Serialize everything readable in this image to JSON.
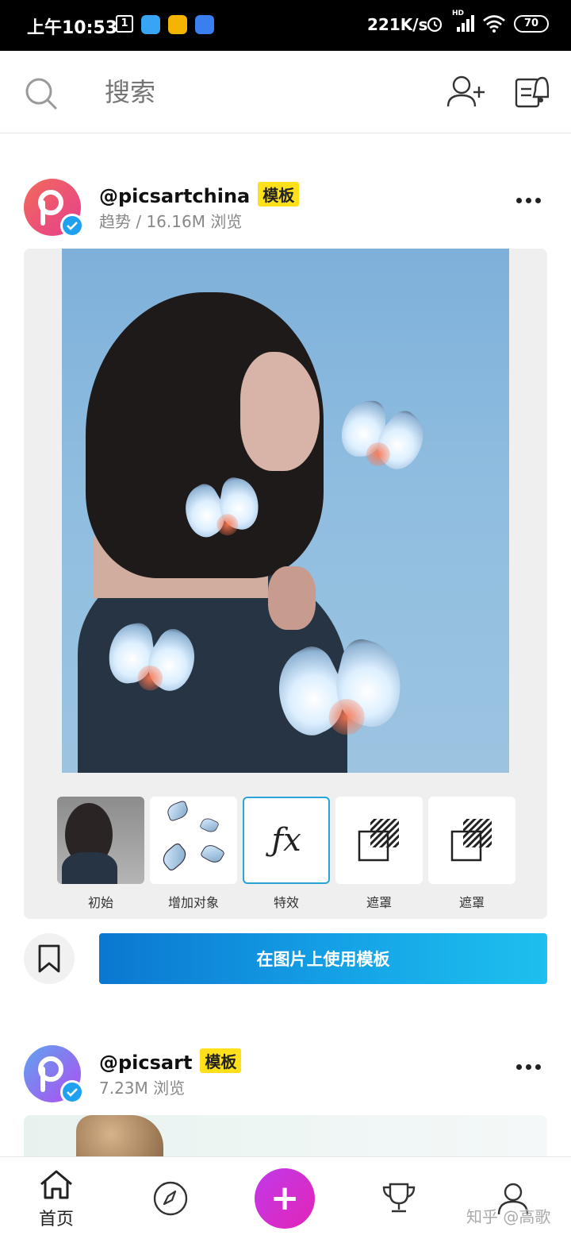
{
  "status_bar": {
    "time": "上午10:53",
    "sim_label": "1",
    "speed": "221K/s",
    "network_label": "HD",
    "battery": "70"
  },
  "header": {
    "search_placeholder": "搜索"
  },
  "posts": [
    {
      "username": "@picsartchina",
      "tag": "模板",
      "meta": "趋势 / 16.16M 浏览",
      "steps": [
        {
          "label": "初始"
        },
        {
          "label": "增加对象"
        },
        {
          "label": "特效",
          "icon_text": "ƒx"
        },
        {
          "label": "遮罩"
        },
        {
          "label": "遮罩"
        }
      ],
      "use_button": "在图片上使用模板"
    },
    {
      "username": "@picsart",
      "tag": "模板",
      "meta": "7.23M 浏览"
    }
  ],
  "bottom_nav": {
    "home_label": "首页",
    "create_label": "+"
  },
  "watermark": "知乎 @高歌",
  "colors": {
    "accent": "#16a6e8",
    "tag": "#ffe01b",
    "create": "#d22ed0"
  }
}
